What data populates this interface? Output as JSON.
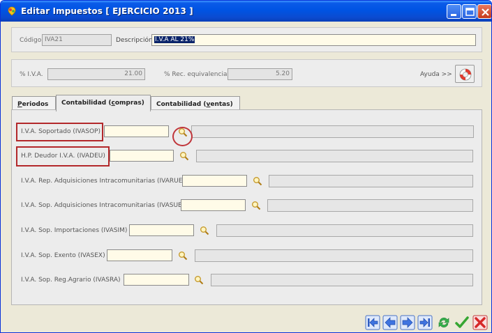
{
  "window": {
    "title": "Editar Impuestos [ EJERCICIO 2013 ]"
  },
  "header": {
    "codigo_label": "Código",
    "codigo_value": "IVA21",
    "descripcion_label": "Descripción",
    "descripcion_value": "I.V.A AL 21%"
  },
  "rates": {
    "iva_label": "% I.V.A.",
    "iva_value": "21.00",
    "rec_label": "% Rec. equivalencia",
    "rec_value": "5.20",
    "help_label": "Ayuda >>"
  },
  "tabs": [
    {
      "label": "Periodos",
      "underline": "P",
      "rest": "eriodos"
    },
    {
      "label": "Contabilidad (compras)",
      "pre": "Contabilidad (",
      "underline": "c",
      "post": "ompras)"
    },
    {
      "label": "Contabilidad (ventas)",
      "pre": "Contabilidad (",
      "underline": "v",
      "post": "entas)"
    }
  ],
  "accounts": [
    {
      "label": "I.V.A. Soportado (IVASOP)",
      "value": "",
      "desc": ""
    },
    {
      "label": "H.P. Deudor I.V.A. (IVADEU)",
      "value": "",
      "desc": ""
    },
    {
      "label": "I.V.A. Rep. Adquisiciones Intracomunitarias (IVARUE)",
      "value": "",
      "desc": ""
    },
    {
      "label": "I.V.A. Sop. Adquisiciones Intracomunitarias (IVASUE)",
      "value": "",
      "desc": ""
    },
    {
      "label": "I.V.A. Sop. Importaciones (IVASIM)",
      "value": "",
      "desc": ""
    },
    {
      "label": "I.V.A. Sop. Exento (IVASEX)",
      "value": "",
      "desc": ""
    },
    {
      "label": "I.V.A. Sop. Reg.Agrario (IVASRA)",
      "value": "",
      "desc": ""
    }
  ],
  "colors": {
    "titlebar": "#0054e3",
    "highlight": "#b3282a",
    "input_bg": "#fffbe8"
  },
  "icons": {
    "search": "magnifier-icon",
    "help": "lifebuoy-icon",
    "nav": [
      "first-icon",
      "previous-icon",
      "next-icon",
      "last-icon",
      "refresh-icon",
      "accept-icon",
      "cancel-icon"
    ]
  }
}
